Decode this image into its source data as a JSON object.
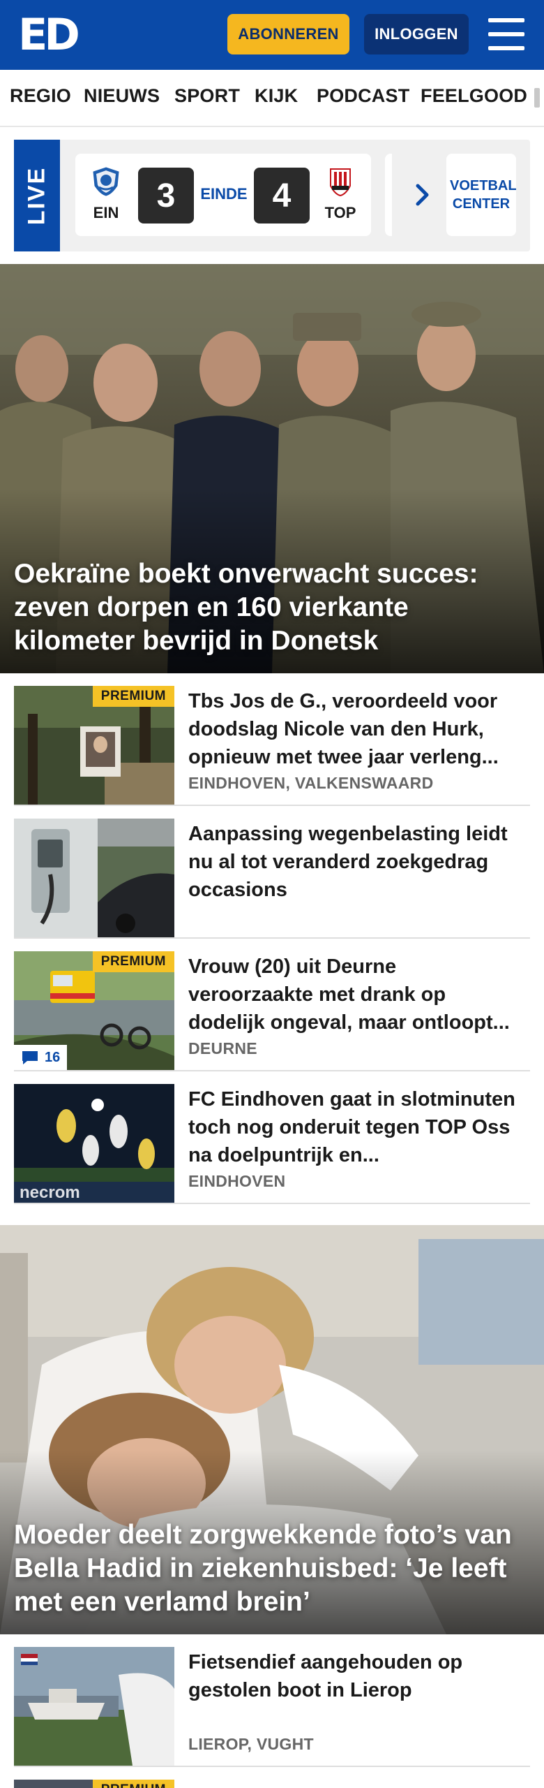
{
  "header": {
    "logo": "ED",
    "subscribe_label": "ABONNEREN",
    "login_label": "INLOGGEN"
  },
  "nav": {
    "items": [
      "REGIO",
      "NIEUWS",
      "SPORT",
      "KIJK",
      "PODCAST",
      "FEELGOOD"
    ]
  },
  "live": {
    "label": "LIVE",
    "match": {
      "home_code": "EIN",
      "home_score": "3",
      "status": "EINDE",
      "away_score": "4",
      "away_code": "TOP"
    },
    "voetbal_center_label": "VOETBAL CENTER"
  },
  "hero1": {
    "title": "Oekraïne boekt onverwacht succes: zeven dorpen en 160 vierkante kilometer bevrijd in Donetsk"
  },
  "articles": [
    {
      "title": "Tbs Jos de G., veroordeeld voor doodslag Nicole van den Hurk, opnieuw met twee jaar verleng...",
      "meta": "EINDHOVEN, VALKENSWAARD",
      "premium": "PREMIUM"
    },
    {
      "title": "Aanpassing wegenbelasting leidt nu al tot veranderd zoekgedrag occasions",
      "meta": ""
    },
    {
      "title": "Vrouw (20) uit Deurne veroorzaakte met drank op dodelijk ongeval, maar ontloopt...",
      "meta": "DEURNE",
      "premium": "PREMIUM",
      "comments": "16"
    },
    {
      "title": "FC Eindhoven gaat in slotminu­ten toch nog onderuit tegen TOP Oss na doelpuntrijk en...",
      "meta": "EINDHOVEN"
    }
  ],
  "hero2": {
    "title": "Moeder deelt zorgwekkende foto’s van Bella Hadid in ziekenhuisbed: ‘Je leeft met een verlamd brein’"
  },
  "articles2": [
    {
      "title": "Fietsendief aangehouden op gestolen boot in Lierop",
      "meta": "LIEROP, VUGHT"
    },
    {
      "premium": "PREMIUM"
    }
  ],
  "colors": {
    "brand_blue": "#0a4aa8",
    "subscribe_yellow": "#f5b71f",
    "premium_yellow": "#f5c226"
  },
  "icons": [
    "menu-icon",
    "chevron-right-icon",
    "comment-icon",
    "fc-eindhoven-crest-icon",
    "top-oss-crest-icon"
  ]
}
